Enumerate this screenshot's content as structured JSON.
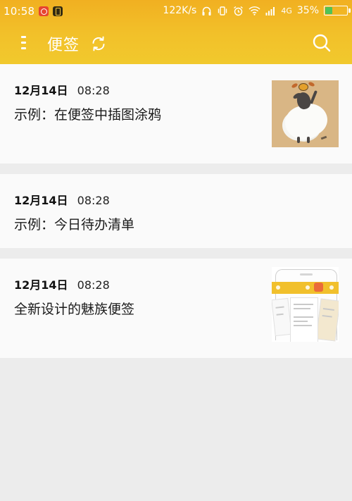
{
  "status_bar": {
    "time": "10:58",
    "speed": "122K/s",
    "network": "4G",
    "battery_percent": "35%",
    "battery_level": 0.35,
    "left_icons": [
      "netease-music-icon",
      "battery-saver-icon"
    ],
    "right_icons": [
      "headphones-icon",
      "vibrate-icon",
      "alarm-icon",
      "wifi-icon",
      "signal-icon",
      "battery-icon"
    ]
  },
  "app_bar": {
    "title": "便签",
    "icons": [
      "menu-icon",
      "sync-icon",
      "search-icon"
    ]
  },
  "notes": [
    {
      "date": "12月14日",
      "time": "08:28",
      "title": "示例：在便签中插图涂鸦",
      "thumbnail": "sheep-doodle-image"
    },
    {
      "date": "12月14日",
      "time": "08:28",
      "title": "示例：今日待办清单",
      "thumbnail": null
    },
    {
      "date": "12月14日",
      "time": "08:28",
      "title": "全新设计的魅族便签",
      "thumbnail": "app-preview-image"
    }
  ],
  "colors": {
    "header_top": "#f1b021",
    "header_bottom": "#f1c92d",
    "card_background": "#fafafa",
    "list_background": "#ececec",
    "battery_fill": "#4fc25a"
  }
}
